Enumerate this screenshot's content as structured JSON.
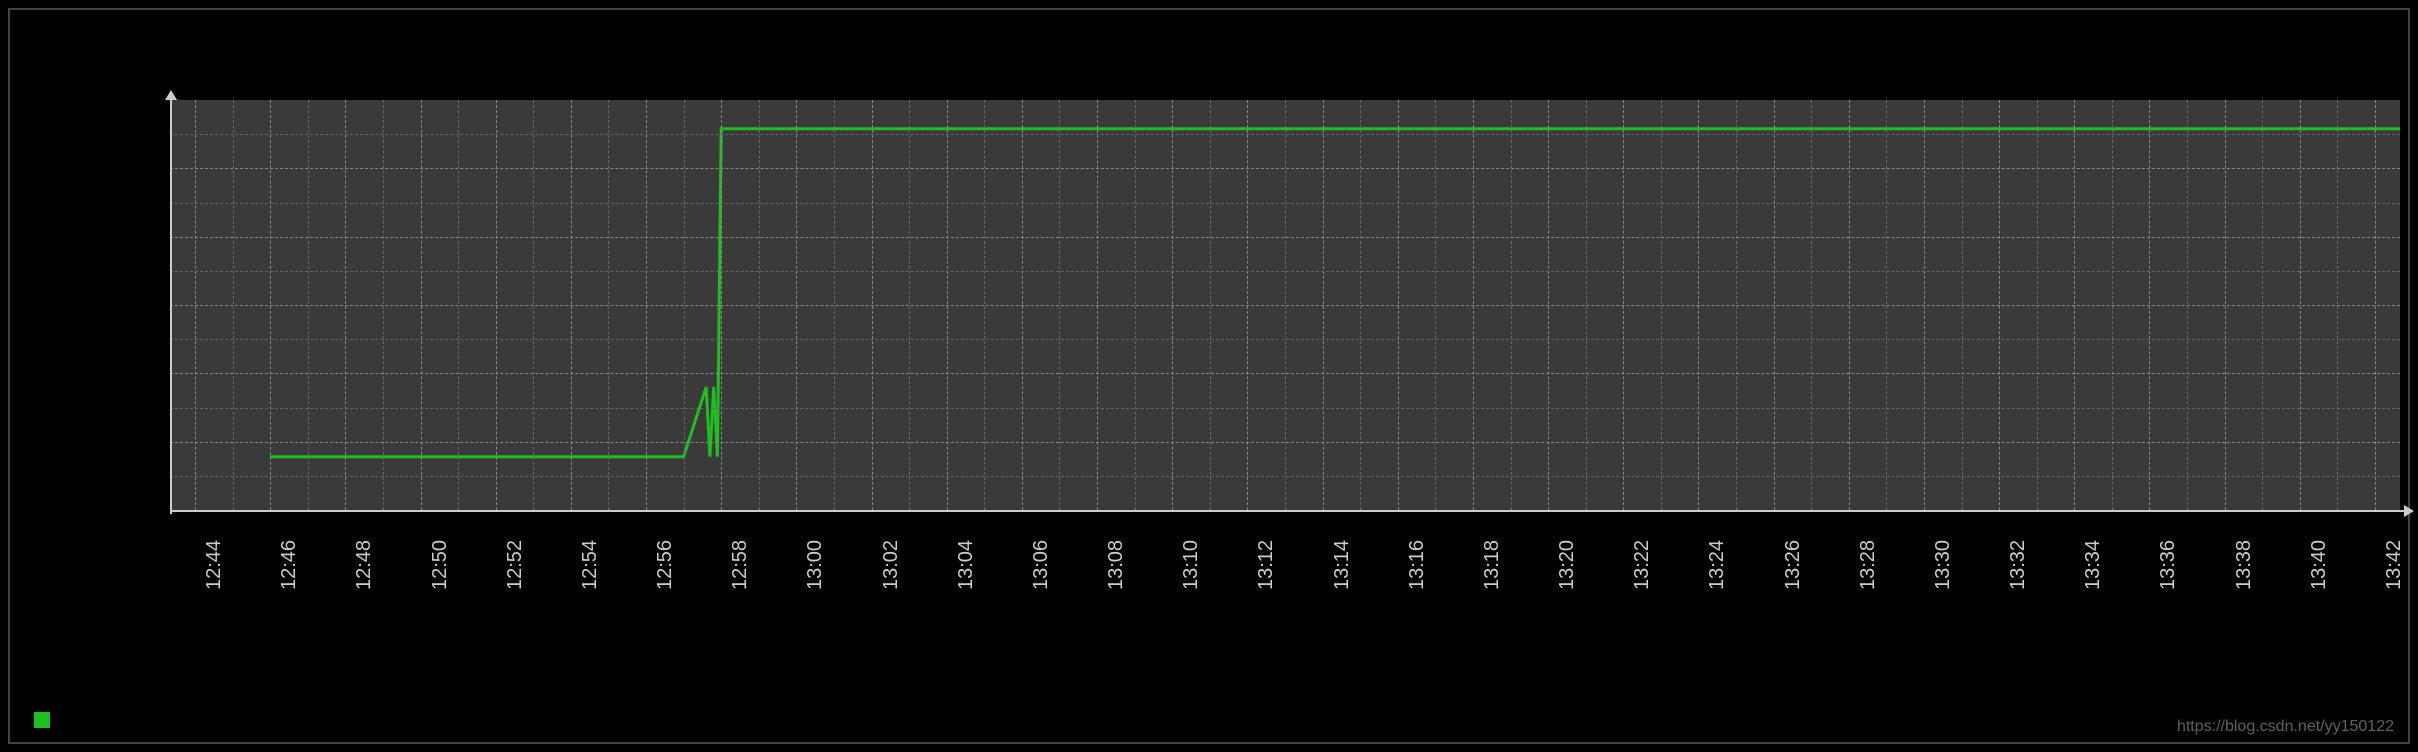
{
  "watermark": "https://blog.csdn.net/yy150122",
  "chart_data": {
    "type": "line",
    "title": "",
    "xlabel": "",
    "ylabel": "",
    "ylim": [
      0,
      1.0
    ],
    "x_ticks": [
      "12:44",
      "12:46",
      "12:48",
      "12:50",
      "12:52",
      "12:54",
      "12:56",
      "12:58",
      "13:00",
      "13:02",
      "13:04",
      "13:06",
      "13:08",
      "13:10",
      "13:12",
      "13:14",
      "13:16",
      "13:18",
      "13:20",
      "13:22",
      "13:24",
      "13:26",
      "13:28",
      "13:30",
      "13:32",
      "13:34",
      "13:36",
      "13:38",
      "13:40",
      "13:42"
    ],
    "grid": true,
    "series": [
      {
        "name": "",
        "color": "#1fbf1f",
        "data": [
          {
            "x": "12:46",
            "y": 0.13
          },
          {
            "x": "12:48",
            "y": 0.13
          },
          {
            "x": "12:50",
            "y": 0.13
          },
          {
            "x": "12:52",
            "y": 0.13
          },
          {
            "x": "12:54",
            "y": 0.13
          },
          {
            "x": "12:56",
            "y": 0.13
          },
          {
            "x": "12:57",
            "y": 0.13
          },
          {
            "x": "12:57.6",
            "y": 0.3
          },
          {
            "x": "12:57.7",
            "y": 0.13
          },
          {
            "x": "12:57.8",
            "y": 0.3
          },
          {
            "x": "12:57.9",
            "y": 0.13
          },
          {
            "x": "12:58",
            "y": 0.93
          },
          {
            "x": "13:00",
            "y": 0.93
          },
          {
            "x": "13:02",
            "y": 0.93
          },
          {
            "x": "13:04",
            "y": 0.93
          },
          {
            "x": "13:06",
            "y": 0.93
          },
          {
            "x": "13:08",
            "y": 0.93
          },
          {
            "x": "13:10",
            "y": 0.93
          },
          {
            "x": "13:12",
            "y": 0.93
          },
          {
            "x": "13:14",
            "y": 0.93
          },
          {
            "x": "13:16",
            "y": 0.93
          },
          {
            "x": "13:18",
            "y": 0.93
          },
          {
            "x": "13:20",
            "y": 0.93
          },
          {
            "x": "13:22",
            "y": 0.93
          },
          {
            "x": "13:24",
            "y": 0.93
          },
          {
            "x": "13:26",
            "y": 0.93
          },
          {
            "x": "13:28",
            "y": 0.93
          },
          {
            "x": "13:30",
            "y": 0.93
          },
          {
            "x": "13:32",
            "y": 0.93
          },
          {
            "x": "13:34",
            "y": 0.93
          },
          {
            "x": "13:36",
            "y": 0.93
          },
          {
            "x": "13:38",
            "y": 0.93
          },
          {
            "x": "13:40",
            "y": 0.93
          },
          {
            "x": "13:42",
            "y": 0.93
          },
          {
            "x": "13:43",
            "y": 0.93
          }
        ]
      }
    ]
  }
}
